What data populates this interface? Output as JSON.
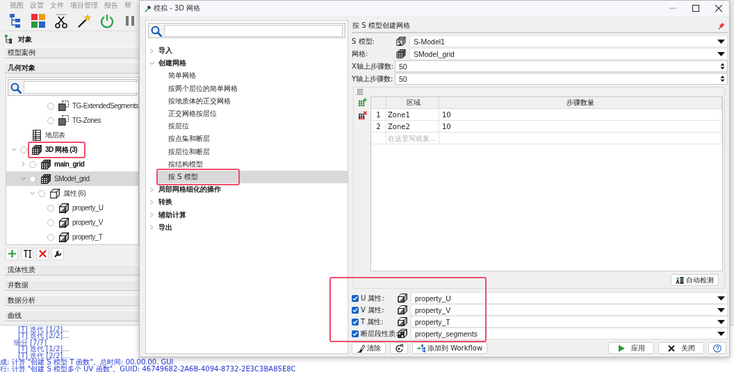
{
  "app": {
    "menu": [
      "视图",
      "设置",
      "文件",
      "项目管理",
      "报告",
      "帮"
    ],
    "objects_title": "对象",
    "top_sections": [
      "模型案例",
      "几何对象"
    ],
    "tree_continued": [
      {
        "label": "TG-ExtendedSegments",
        "kind": "surface",
        "checked": false,
        "selected": false
      },
      {
        "label": "TG-Zones",
        "kind": "surface",
        "checked": false,
        "selected": false
      }
    ],
    "tree": [
      {
        "label": "地层表",
        "kind": "table",
        "selected": false
      },
      {
        "label": "3D 网格 (3)",
        "kind": "grid",
        "bold": true,
        "checked": false,
        "expanded": true,
        "highlighted": true,
        "selected": false,
        "children": [
          {
            "label": "main_grid",
            "kind": "grid",
            "bold": true,
            "checked": false,
            "expanded": false,
            "selected": false
          },
          {
            "label": "SModel_grid",
            "kind": "grid",
            "checked": false,
            "expanded": true,
            "selected": true,
            "children": [
              {
                "label": "属性 (6)",
                "kind": "folder",
                "checked": false,
                "expanded": true,
                "selected": false,
                "children": [
                  {
                    "label": "property_U",
                    "kind": "property",
                    "checked": false,
                    "selected": false
                  },
                  {
                    "label": "property_V",
                    "kind": "property",
                    "checked": false,
                    "selected": false
                  },
                  {
                    "label": "property_T",
                    "kind": "property",
                    "checked": false,
                    "selected": false
                  }
                ]
              }
            ]
          }
        ]
      }
    ],
    "bottom_sections": [
      "流体性质",
      "井数据",
      "数据分析",
      "曲线"
    ],
    "log": [
      {
        "kind": "step",
        "text": "[T] 迭代 [1/2]..."
      },
      {
        "kind": "step",
        "text": "[T] 迭代 [2/2]..."
      },
      {
        "kind": "stage",
        "text": "细分 [7/7]"
      },
      {
        "kind": "step",
        "text": "[T] 迭代 [1/2]..."
      },
      {
        "kind": "step",
        "text": "[T] 迭代 [2/2]..."
      },
      {
        "kind": "message",
        "text": "成: 计算 \"创建 S 模型 T 函数\"。总时间: 00.00.00. GUI"
      },
      {
        "kind": "message",
        "text": "行: 计算 \"创建 S 模型多个 UV 函数\"。GUID: 46749682-2A6B-4094-8732-2E3C3BA85E8C"
      }
    ]
  },
  "dialog": {
    "title": "模拟 - 3D 网格",
    "nav": [
      {
        "label": "导入",
        "expanded": false,
        "selected": false
      },
      {
        "label": "创建网格",
        "expanded": true,
        "selected": false,
        "children": [
          {
            "label": "简单网格",
            "selected": false
          },
          {
            "label": "按两个层位的简单网格",
            "selected": false
          },
          {
            "label": "按地质体的正交网格",
            "selected": false
          },
          {
            "label": "正交网格按层位",
            "selected": false
          },
          {
            "label": "按层位",
            "selected": false
          },
          {
            "label": "按点集和断层",
            "selected": false
          },
          {
            "label": "按层位和断层",
            "selected": false
          },
          {
            "label": "按结构模型",
            "selected": false
          },
          {
            "label": "按 S 模型",
            "selected": true,
            "highlighted": true
          }
        ]
      },
      {
        "label": "局部网格细化的操作",
        "expanded": false,
        "selected": false
      },
      {
        "label": "转换",
        "expanded": false,
        "selected": false
      },
      {
        "label": "辅助计算",
        "expanded": false,
        "selected": false
      },
      {
        "label": "导出",
        "expanded": false,
        "selected": false
      }
    ],
    "panel_title": "按 S 模型创建网格",
    "fields": [
      {
        "kind": "dropdown",
        "label": "S 模型:",
        "value": "S-Model1"
      },
      {
        "kind": "dropdown",
        "label": "网格:",
        "value": "SModel_grid"
      },
      {
        "kind": "spinner",
        "label": "X轴上步骤数:",
        "value": "50"
      },
      {
        "kind": "spinner",
        "label": "Y轴上步骤数:",
        "value": "50"
      }
    ],
    "layers": {
      "title": "层",
      "columns": [
        "区域",
        "步骤数量"
      ],
      "rows": [
        {
          "number": "1",
          "cells": [
            "Zone1",
            "10"
          ]
        },
        {
          "number": "2",
          "cells": [
            "Zone2",
            "10"
          ]
        }
      ],
      "new_row": {
        "placeholder": "在这里写或复..."
      }
    },
    "auto_detect": "自动检测",
    "properties": {
      "highlighted": true,
      "rows": [
        {
          "checked": true,
          "label": "U 属性:",
          "value": "property_U"
        },
        {
          "checked": true,
          "label": "V 属性:",
          "value": "property_V"
        },
        {
          "checked": true,
          "label": "T 属性:",
          "value": "property_T"
        },
        {
          "checked": true,
          "label": "断层段性质:",
          "value": "property_segments"
        }
      ]
    },
    "left_buttons": [
      {
        "kind": "clear",
        "label": "清除"
      },
      {
        "kind": "refresh"
      },
      {
        "kind": "workflow",
        "label": "添加到 Workflow"
      }
    ],
    "right_buttons": [
      {
        "kind": "apply",
        "label": "应用"
      },
      {
        "kind": "close",
        "label": "关闭"
      },
      {
        "kind": "help"
      }
    ]
  }
}
